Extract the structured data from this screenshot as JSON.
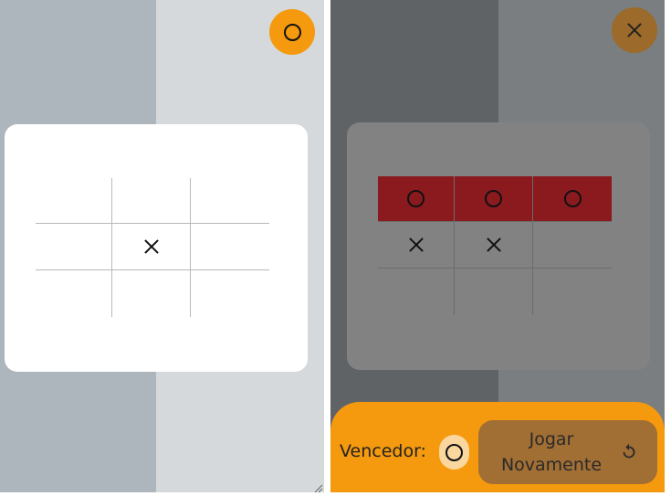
{
  "left_panel": {
    "turn_indicator": {
      "player": "O",
      "icon": "circle-icon"
    },
    "board": [
      [
        "",
        "",
        ""
      ],
      [
        "",
        "X",
        ""
      ],
      [
        "",
        "",
        ""
      ]
    ]
  },
  "right_panel": {
    "turn_indicator": {
      "player": "X",
      "icon": "cross-icon"
    },
    "board": [
      [
        "O",
        "O",
        "O"
      ],
      [
        "X",
        "X",
        ""
      ],
      [
        "",
        "",
        ""
      ]
    ],
    "winning_row": 0,
    "result": {
      "winner_label": "Vencedor:",
      "winner_player": "O",
      "replay_label": "Jogar Novamente",
      "replay_icon": "restart-icon"
    }
  },
  "colors": {
    "accent": "#f5990e",
    "win_highlight": "#8b1a1f",
    "replay_button": "#a16e34",
    "winner_badge": "#fad79e"
  }
}
